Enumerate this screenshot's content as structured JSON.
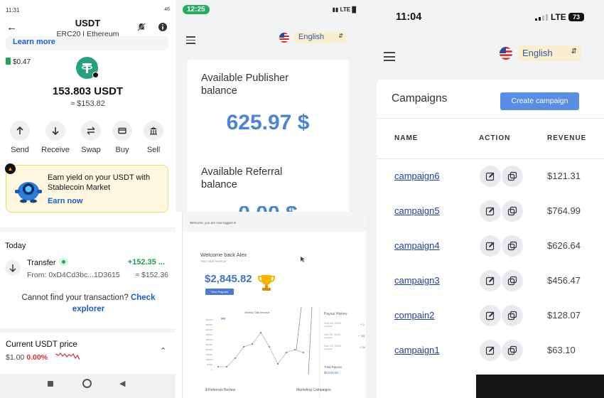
{
  "wallet": {
    "status_time": "11:31",
    "status_right": "46",
    "title": "USDT",
    "subtitle": "ERC20 | Ethereum",
    "learn_more": "Learn more",
    "fee": "$0.47",
    "amount": "153.803 USDT",
    "amount_fiat": "≈ $153.82",
    "actions": [
      "Send",
      "Receive",
      "Swap",
      "Buy",
      "Sell"
    ],
    "promo_text": "Earn yield on your USDT with Stablecoin Market",
    "promo_link": "Earn now",
    "today": "Today",
    "tx_title": "Transfer",
    "tx_amount": "+152.35 ...",
    "tx_from": "From: 0xD4Cd3bc...1D3615",
    "tx_fiat": "≈ $152.36",
    "cannot_text": "Cannot find your transaction?",
    "cannot_link": "Check explorer",
    "price_title": "Current USDT price",
    "price_value": "$1.00",
    "price_change": "0.00%",
    "colors": {
      "coin": "#26a17b",
      "link": "#1a5bd6",
      "positive": "#1d9b50",
      "negative": "#d0312d"
    }
  },
  "publisher": {
    "status_time": "12:25",
    "status_right": "LTE",
    "language": "English",
    "balance_label": "Available Publisher balance",
    "balance_value": "625.97 $",
    "referral_label": "Available Referral balance",
    "referral_value": "0.00 $",
    "accent": "#4a84d6"
  },
  "dashboard": {
    "top_text": "Welcome, you are now logged in",
    "welcome": "Welcome back Alex",
    "welcome_sub": "Your total revenue",
    "balance": "$2,845.82",
    "button": "View Payouts",
    "chart_title": "Monthly Total rev.enue",
    "payout_title": "Payout History",
    "payouts": [
      {
        "date": "Sep 06, 2024",
        "status": "Available",
        "amount": "+ 2."
      },
      {
        "date": "Oct 09, 2024",
        "status": "Available",
        "amount": "+ 251"
      },
      {
        "date": "Nov 02, 2024",
        "status": "Available",
        "amount": "+ 34"
      }
    ],
    "total_payout_label": "Total Payout",
    "total_payout_value": "$3,845.82",
    "referrals": "$ Referrals Review",
    "marketing": "Marketing Campaigns",
    "y_ticks": [
      "500,000",
      "450,000",
      "400,000",
      "350,000",
      "300,000",
      "250,000",
      "200,000",
      "150,000",
      "100,000",
      "50,000",
      "0"
    ]
  },
  "campaigns": {
    "status_time": "11:04",
    "status_net": "LTE",
    "battery": "73",
    "language": "English",
    "title": "Campaigns",
    "create_button": "Create campaign",
    "headers": {
      "name": "NAME",
      "action": "ACTION",
      "revenue": "REVENUE"
    },
    "rows": [
      {
        "name": "campaign6",
        "revenue": "$121.31"
      },
      {
        "name": "campaign5",
        "revenue": "$764.99"
      },
      {
        "name": "campaign4",
        "revenue": "$626.64"
      },
      {
        "name": "campaign3",
        "revenue": "$456.47"
      },
      {
        "name": "compain2",
        "revenue": "$128.07"
      },
      {
        "name": "campaign1",
        "revenue": "$63.10"
      }
    ],
    "colors": {
      "button": "#5a8ee6",
      "link": "#1f3fa0",
      "lang_bg": "#f9eecd"
    }
  }
}
